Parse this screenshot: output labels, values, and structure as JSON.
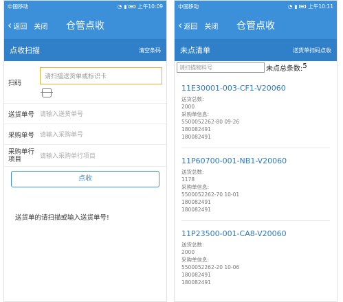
{
  "status_left": {
    "carrier": "中国移动",
    "time": "上午10:09"
  },
  "status_right": {
    "carrier": "中国移动",
    "time": "上午10:11"
  },
  "nav": {
    "back": "返回",
    "close": "关闭",
    "title": "仓管点收"
  },
  "left": {
    "section_title": "点收扫描",
    "section_action": "清空条码",
    "scan_label": "扫码",
    "scan_placeholder": "请扫描送货单或标识卡",
    "fields": [
      {
        "label": "送货单号",
        "placeholder": "请输入送货单号"
      },
      {
        "label": "采购单号",
        "placeholder": "请输入采购单号"
      },
      {
        "label": "采购单行项目",
        "placeholder": "请输入采购单行项目"
      }
    ],
    "button": "点收",
    "hint": "送货单的请扫描或输入送货单号!"
  },
  "right": {
    "section_title": "未点清单",
    "section_action": "送货单扫码点收",
    "search_placeholder": "请扫描物料号",
    "count_label": "未点总条数:",
    "count_value": "5",
    "items": [
      {
        "code": "11E30001-003-CF1-V20060",
        "total_label": "送货总数:",
        "total": "2000",
        "info_label": "采购单信息:",
        "po": "5500052262-80 09-26",
        "line1": "180082491",
        "line2": "180082491"
      },
      {
        "code": "11P60700-001-NB1-V20060",
        "total_label": "送货总数:",
        "total": "1178",
        "info_label": "采购单信息:",
        "po": "5500052262-70 10-01",
        "line1": "180082491",
        "line2": "180082491"
      },
      {
        "code": "11P23500-001-CA8-V20060",
        "total_label": "送货总数:",
        "total": "2000",
        "info_label": "采购单信息:",
        "po": "5500052262-20 10-06",
        "line1": "180082491",
        "line2": "180082491"
      }
    ]
  }
}
